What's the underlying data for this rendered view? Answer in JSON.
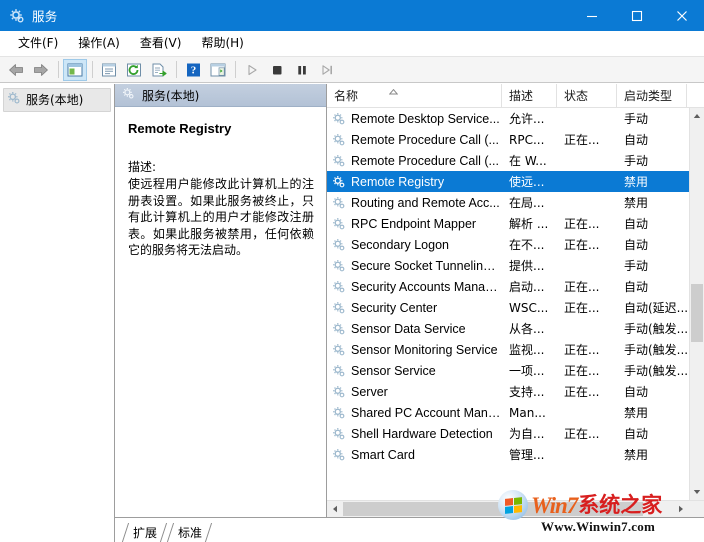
{
  "window": {
    "title": "服务",
    "icon": "services-gear-icon",
    "accent_color": "#0b7ad4",
    "buttons": {
      "minimize": "minimize-icon",
      "maximize": "maximize-icon",
      "close": "close-icon"
    }
  },
  "menubar": {
    "items": [
      {
        "label": "文件(F)"
      },
      {
        "label": "操作(A)"
      },
      {
        "label": "查看(V)"
      },
      {
        "label": "帮助(H)"
      }
    ]
  },
  "toolbar": {
    "items": [
      {
        "name": "back-icon"
      },
      {
        "name": "forward-icon"
      },
      {
        "name": "separator"
      },
      {
        "name": "show-hide-console-tree-icon"
      },
      {
        "name": "separator"
      },
      {
        "name": "properties-icon"
      },
      {
        "name": "refresh-icon"
      },
      {
        "name": "export-list-icon"
      },
      {
        "name": "separator"
      },
      {
        "name": "help-icon"
      },
      {
        "name": "show-action-pane-icon"
      },
      {
        "name": "separator"
      },
      {
        "name": "start-service-icon"
      },
      {
        "name": "stop-service-icon"
      },
      {
        "name": "pause-service-icon"
      },
      {
        "name": "restart-service-icon"
      }
    ]
  },
  "tree_pane": {
    "items": [
      {
        "label": "服务(本地)",
        "icon": "services-gear-icon",
        "selected": true
      }
    ]
  },
  "detail_panel": {
    "header": "服务(本地)",
    "header_icon": "services-gear-icon",
    "service_name": "Remote Registry",
    "description_label": "描述:",
    "description_text": "使远程用户能修改此计算机上的注册表设置。如果此服务被终止，只有此计算机上的用户才能修改注册表。如果此服务被禁用，任何依赖它的服务将无法启动。"
  },
  "list": {
    "columns": [
      {
        "label": "名称",
        "width": 175,
        "sorted": "asc"
      },
      {
        "label": "描述",
        "width": 55
      },
      {
        "label": "状态",
        "width": 60
      },
      {
        "label": "启动类型",
        "width": 70
      }
    ],
    "sort_indicator": "▲",
    "rows": [
      {
        "name": "Remote Desktop Service...",
        "description": "允许...",
        "status": "",
        "startup": "手动",
        "selected": false
      },
      {
        "name": "Remote Procedure Call (...",
        "description": "RPC...",
        "status": "正在...",
        "startup": "自动",
        "selected": false
      },
      {
        "name": "Remote Procedure Call (...",
        "description": "在 W...",
        "status": "",
        "startup": "手动",
        "selected": false
      },
      {
        "name": "Remote Registry",
        "description": "使远...",
        "status": "",
        "startup": "禁用",
        "selected": true
      },
      {
        "name": "Routing and Remote Acc...",
        "description": "在局...",
        "status": "",
        "startup": "禁用",
        "selected": false
      },
      {
        "name": "RPC Endpoint Mapper",
        "description": "解析 ...",
        "status": "正在...",
        "startup": "自动",
        "selected": false
      },
      {
        "name": "Secondary Logon",
        "description": "在不...",
        "status": "正在...",
        "startup": "自动",
        "selected": false
      },
      {
        "name": "Secure Socket Tunneling ...",
        "description": "提供...",
        "status": "",
        "startup": "手动",
        "selected": false
      },
      {
        "name": "Security Accounts Manag...",
        "description": "启动...",
        "status": "正在...",
        "startup": "自动",
        "selected": false
      },
      {
        "name": "Security Center",
        "description": "WSC...",
        "status": "正在...",
        "startup": "自动(延迟...",
        "selected": false
      },
      {
        "name": "Sensor Data Service",
        "description": "从各...",
        "status": "",
        "startup": "手动(触发...",
        "selected": false
      },
      {
        "name": "Sensor Monitoring Service",
        "description": "监视...",
        "status": "正在...",
        "startup": "手动(触发...",
        "selected": false
      },
      {
        "name": "Sensor Service",
        "description": "一项...",
        "status": "正在...",
        "startup": "手动(触发...",
        "selected": false
      },
      {
        "name": "Server",
        "description": "支持...",
        "status": "正在...",
        "startup": "自动",
        "selected": false
      },
      {
        "name": "Shared PC Account Mana...",
        "description": "Man...",
        "status": "",
        "startup": "禁用",
        "selected": false
      },
      {
        "name": "Shell Hardware Detection",
        "description": "为自...",
        "status": "正在...",
        "startup": "自动",
        "selected": false
      },
      {
        "name": "Smart Card",
        "description": "管理...",
        "status": "",
        "startup": "禁用",
        "selected": false
      }
    ]
  },
  "tabs": [
    {
      "label": "扩展"
    },
    {
      "label": "标准"
    }
  ],
  "watermark": {
    "brand_latin": "Win7",
    "brand_cn": "系统之家",
    "url": "Www.Winwin7.com"
  }
}
